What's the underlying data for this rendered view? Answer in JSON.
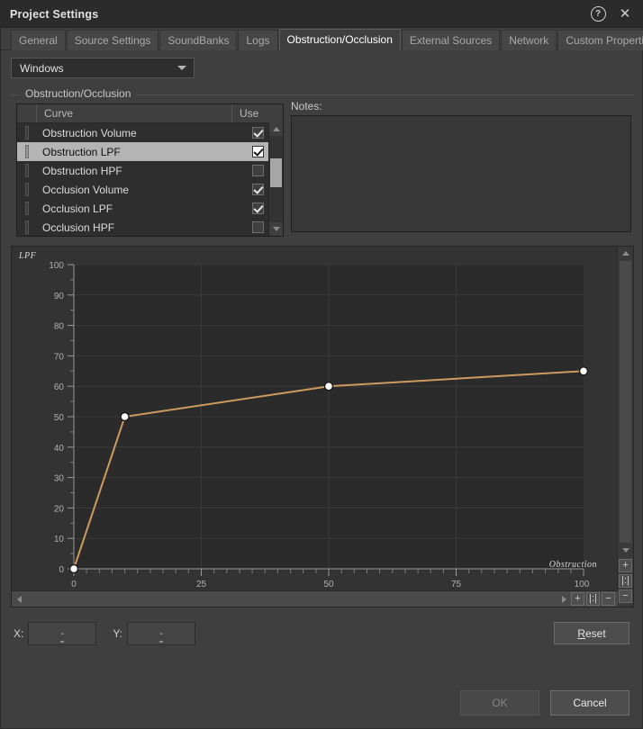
{
  "window": {
    "title": "Project Settings",
    "help_icon": "help-icon",
    "close_icon": "close-icon",
    "help_glyph": "?",
    "close_glyph": "✕"
  },
  "tabs": [
    {
      "label": "General",
      "active": false
    },
    {
      "label": "Source Settings",
      "active": false
    },
    {
      "label": "SoundBanks",
      "active": false
    },
    {
      "label": "Logs",
      "active": false
    },
    {
      "label": "Obstruction/Occlusion",
      "active": true
    },
    {
      "label": "External Sources",
      "active": false
    },
    {
      "label": "Network",
      "active": false
    },
    {
      "label": "Custom Properties",
      "active": false
    }
  ],
  "platform": {
    "selected": "Windows",
    "options": [
      "Windows"
    ]
  },
  "group": {
    "title": "Obstruction/Occlusion"
  },
  "curve_list": {
    "columns": [
      "",
      "Curve",
      "Use"
    ],
    "rows": [
      {
        "name": "Obstruction Volume",
        "use": true,
        "selected": false
      },
      {
        "name": "Obstruction LPF",
        "use": true,
        "selected": true
      },
      {
        "name": "Obstruction HPF",
        "use": false,
        "selected": false
      },
      {
        "name": "Occlusion Volume",
        "use": true,
        "selected": false
      },
      {
        "name": "Occlusion LPF",
        "use": true,
        "selected": false
      },
      {
        "name": "Occlusion HPF",
        "use": false,
        "selected": false
      }
    ],
    "scroll_up_icon": "chevron-up-icon",
    "scroll_down_icon": "chevron-down-icon"
  },
  "notes": {
    "label": "Notes:",
    "value": ""
  },
  "graph_controls": {
    "zoom_in_label": "+",
    "zoom_fit_label": "|:|",
    "zoom_out_label": "−",
    "h_zoom_in_label": "+",
    "h_zoom_fit_label": "|:|",
    "h_zoom_out_label": "−",
    "scroll_left_icon": "triangle-left-icon",
    "scroll_right_icon": "triangle-right-icon",
    "scroll_up_icon": "triangle-up-icon",
    "scroll_down_icon": "triangle-down-icon"
  },
  "coords": {
    "x_label": "X:",
    "x_value": "-",
    "y_label": "Y:",
    "y_value": "-"
  },
  "buttons": {
    "reset": "Reset",
    "reset_mnemonic": "R",
    "reset_rest": "eset",
    "ok": "OK",
    "cancel": "Cancel"
  },
  "colors": {
    "curve": "#cf9a5f",
    "point_fill": "#ffffff",
    "plot_bg": "#2b2b2b",
    "panel_bg": "#333333",
    "window_bg": "#3f3f3f",
    "selection": "#b4b4b4"
  },
  "chart_data": {
    "type": "line",
    "title": "Obstruction LPF",
    "xlabel": "Obstruction",
    "ylabel": "LPF",
    "xlim": [
      0,
      100
    ],
    "ylim": [
      0,
      100
    ],
    "xticks": [
      0,
      25,
      50,
      75,
      100
    ],
    "yticks": [
      0,
      10,
      20,
      30,
      40,
      50,
      60,
      70,
      80,
      90,
      100
    ],
    "grid": true,
    "legend": "none",
    "series": [
      {
        "name": "Obstruction LPF",
        "color": "#cf9a5f",
        "points": [
          {
            "x": 0,
            "y": 0
          },
          {
            "x": 10,
            "y": 50
          },
          {
            "x": 50,
            "y": 60
          },
          {
            "x": 100,
            "y": 65
          }
        ]
      }
    ]
  }
}
